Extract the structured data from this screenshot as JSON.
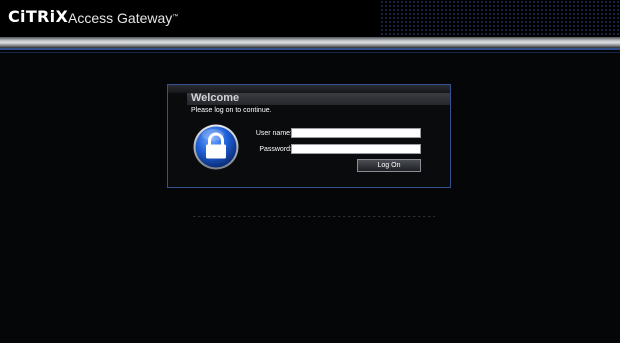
{
  "header": {
    "logo_text": "CiTRiX",
    "product_name": "Access Gateway",
    "product_trademark": "™"
  },
  "login": {
    "title": "Welcome",
    "subtitle": "Please log on to continue.",
    "username_label": "User name:",
    "password_label": "Password:",
    "username_value": "",
    "password_value": "",
    "logon_button": "Log On"
  },
  "colors": {
    "background": "#050607",
    "panel_border": "#34528f",
    "accent_line": "#2e4f8c",
    "lock_blue": "#1f5fd6"
  },
  "icons": {
    "lock": "padlock-icon"
  }
}
